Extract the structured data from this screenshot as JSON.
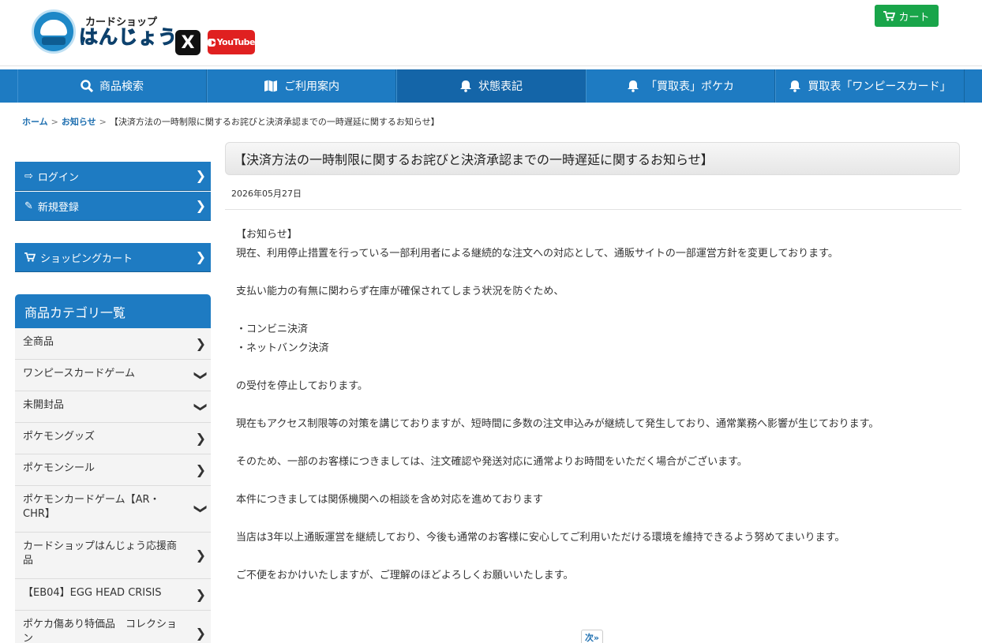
{
  "header": {
    "logo_top": "カードショップ",
    "logo_main": "はんじょう",
    "x_label": "X",
    "youtube_label": "YouTube",
    "cart_label": "カート"
  },
  "nav": [
    {
      "label": "商品検索",
      "icon": "search-icon"
    },
    {
      "label": "ご利用案内",
      "icon": "map-icon"
    },
    {
      "label": "状態表記",
      "icon": "bell-icon"
    },
    {
      "label": "「買取表」ポケカ",
      "icon": "bell-icon"
    },
    {
      "label": "買取表「ワンピースカード」",
      "icon": "bell-icon"
    }
  ],
  "breadcrumb": {
    "home": "ホーム",
    "news": "お知らせ",
    "current": "【決済方法の一時制限に関するお詫びと決済承認までの一時遅延に関するお知らせ】"
  },
  "sidebar": {
    "login": "ログイン",
    "register": "新規登録",
    "cart": "ショッピングカート",
    "category_title": "商品カテゴリ一覧",
    "categories": [
      "全商品",
      "ワンピースカードゲーム",
      "未開封品",
      "ポケモングッズ",
      "ポケモンシール",
      "ポケモンカードゲーム【AR・CHR】",
      "カードショップはんじょう応援商品",
      "【EB04】EGG HEAD CRISIS",
      "ポケカ傷あり特価品　コレクション"
    ]
  },
  "article": {
    "title": "【決済方法の一時制限に関するお詫びと決済承認までの一時遅延に関するお知らせ】",
    "date": "2026年05月27日",
    "heading": "【お知らせ】",
    "p1": "現在、利用停止措置を行っている一部利用者による継続的な注文への対応として、通販サイトの一部運営方針を変更しております。",
    "p2": "支払い能力の有無に関わらず在庫が確保されてしまう状況を防ぐため、",
    "bullet1": "・コンビニ決済",
    "bullet2": "・ネットバンク決済",
    "p3": "の受付を停止しております。",
    "p4": "現在もアクセス制限等の対策を講じておりますが、短時間に多数の注文申込みが継続して発生しており、通常業務へ影響が生じております。",
    "p5": "そのため、一部のお客様につきましては、注文確認や発送対応に通常よりお時間をいただく場合がございます。",
    "p6": "本件につきましては関係機関への相談を含め対応を進めております",
    "p7": "当店は3年以上通販運営を継続しており、今後も通常のお客様に安心してご利用いただける環境を維持できるよう努めてまいります。",
    "p8": "ご不便をおかけいたしますが、ご理解のほどよろしくお願いいたします。",
    "next_label": "次»"
  },
  "colors": {
    "brand_blue": "#1e7bc2",
    "cart_green": "#19a54a",
    "youtube_red": "#e02020"
  }
}
